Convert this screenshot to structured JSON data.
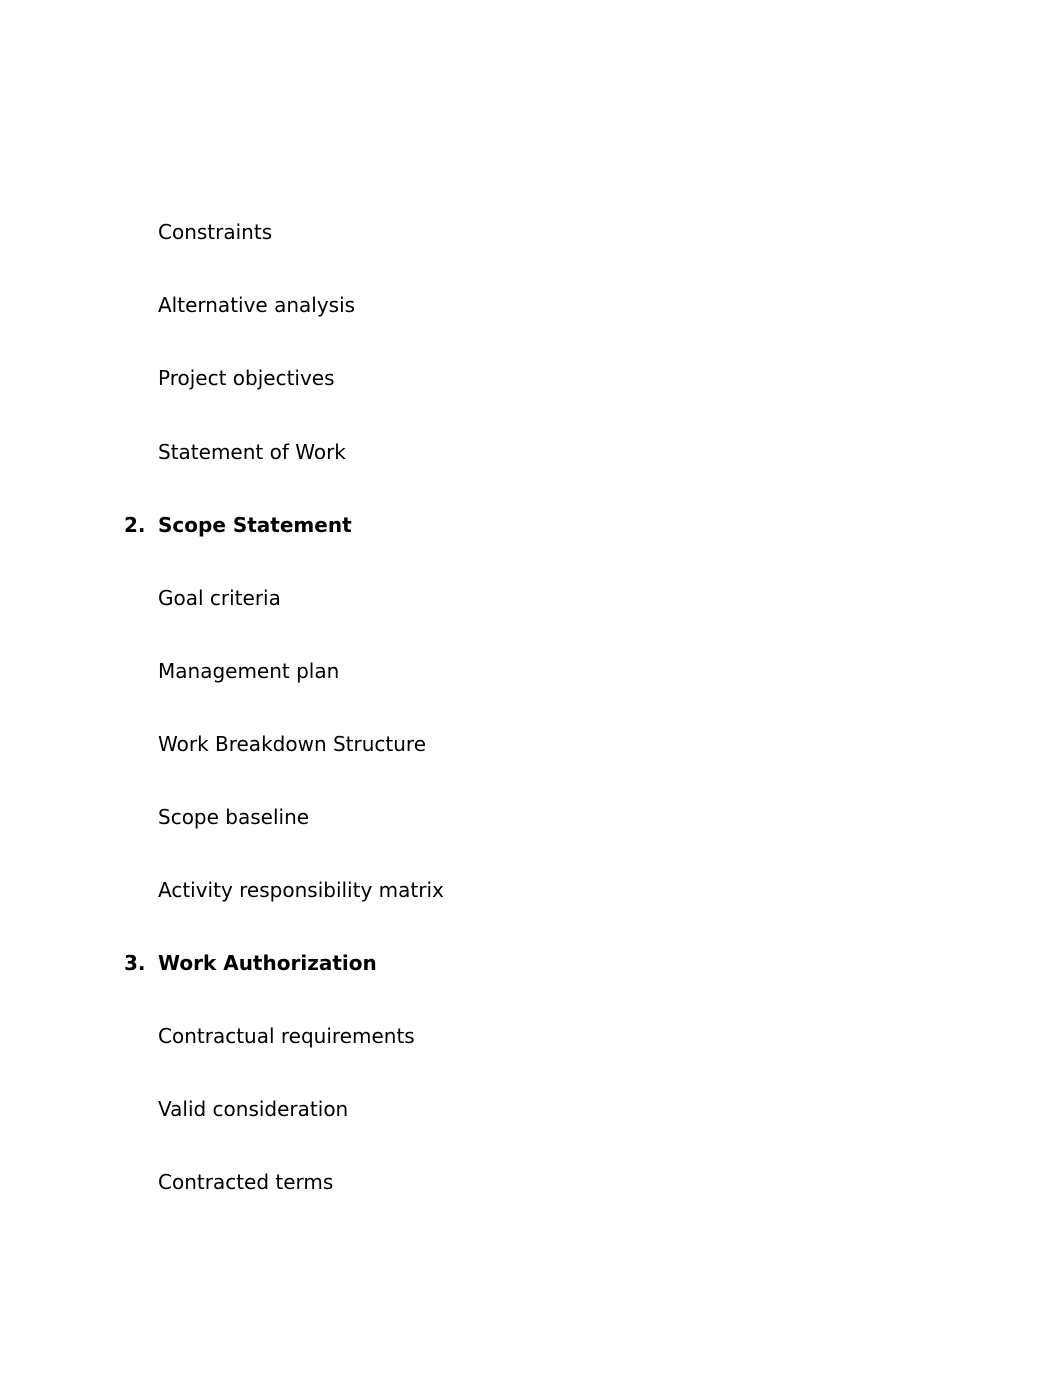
{
  "document": {
    "items": [
      {
        "type": "subitem",
        "text": "Constraints"
      },
      {
        "type": "subitem",
        "text": "Alternative analysis"
      },
      {
        "type": "subitem",
        "text": "Project objectives"
      },
      {
        "type": "subitem",
        "text": "Statement of Work"
      },
      {
        "type": "heading",
        "number": "2.",
        "text": "Scope Statement"
      },
      {
        "type": "subitem",
        "text": "Goal criteria"
      },
      {
        "type": "subitem",
        "text": "Management plan"
      },
      {
        "type": "subitem",
        "text": "Work Breakdown Structure"
      },
      {
        "type": "subitem",
        "text": "Scope baseline"
      },
      {
        "type": "subitem",
        "text": "Activity responsibility matrix"
      },
      {
        "type": "heading",
        "number": "3.",
        "text": "Work Authorization"
      },
      {
        "type": "subitem",
        "text": "Contractual requirements"
      },
      {
        "type": "subitem",
        "text": "Valid consideration"
      },
      {
        "type": "subitem",
        "text": "Contracted terms"
      }
    ]
  }
}
